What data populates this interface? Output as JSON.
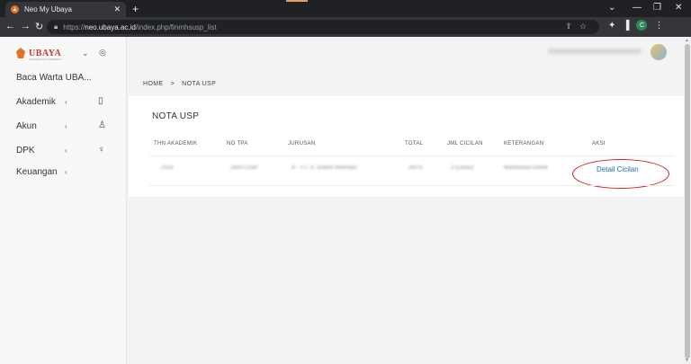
{
  "browser": {
    "tab_title": "Neo My Ubaya",
    "url_host": "neo.ubaya.ac.id",
    "url_prefix": "https://",
    "url_path": "/index.php/finmhsusp_list",
    "profile_initial": "C"
  },
  "sidebar": {
    "logo_text": "UBAYA",
    "logo_sub": "UNIVERSITAS SURABAYA",
    "items": [
      {
        "label": "Baca Warta UBA..."
      },
      {
        "label": "Akademik"
      },
      {
        "label": "Akun"
      },
      {
        "label": "DPK"
      },
      {
        "label": "Keuangan"
      }
    ]
  },
  "breadcrumb": {
    "home": "HOME",
    "separator": ">",
    "current": "NOTA USP"
  },
  "card": {
    "title": "NOTA USP",
    "columns": [
      "THN AKADEMIK",
      "NO TPA",
      "JURUSAN",
      "TOTAL",
      "JML CICILAN",
      "KETERANGAN",
      "AKSI"
    ],
    "row": {
      "thn_akademik": "2018",
      "no_tpa": "180072184",
      "jurusan": "IF - FT. S. Sistem Informasi",
      "total": "300 K",
      "jml_cicilan": "3 (Lunas)",
      "keterangan": "Mahasiswa Online",
      "aksi": "Detail Cicilan"
    }
  },
  "colors": {
    "accent_link": "#1e6bb8",
    "highlight_circle": "#d32020",
    "logo": "#c0392b"
  }
}
